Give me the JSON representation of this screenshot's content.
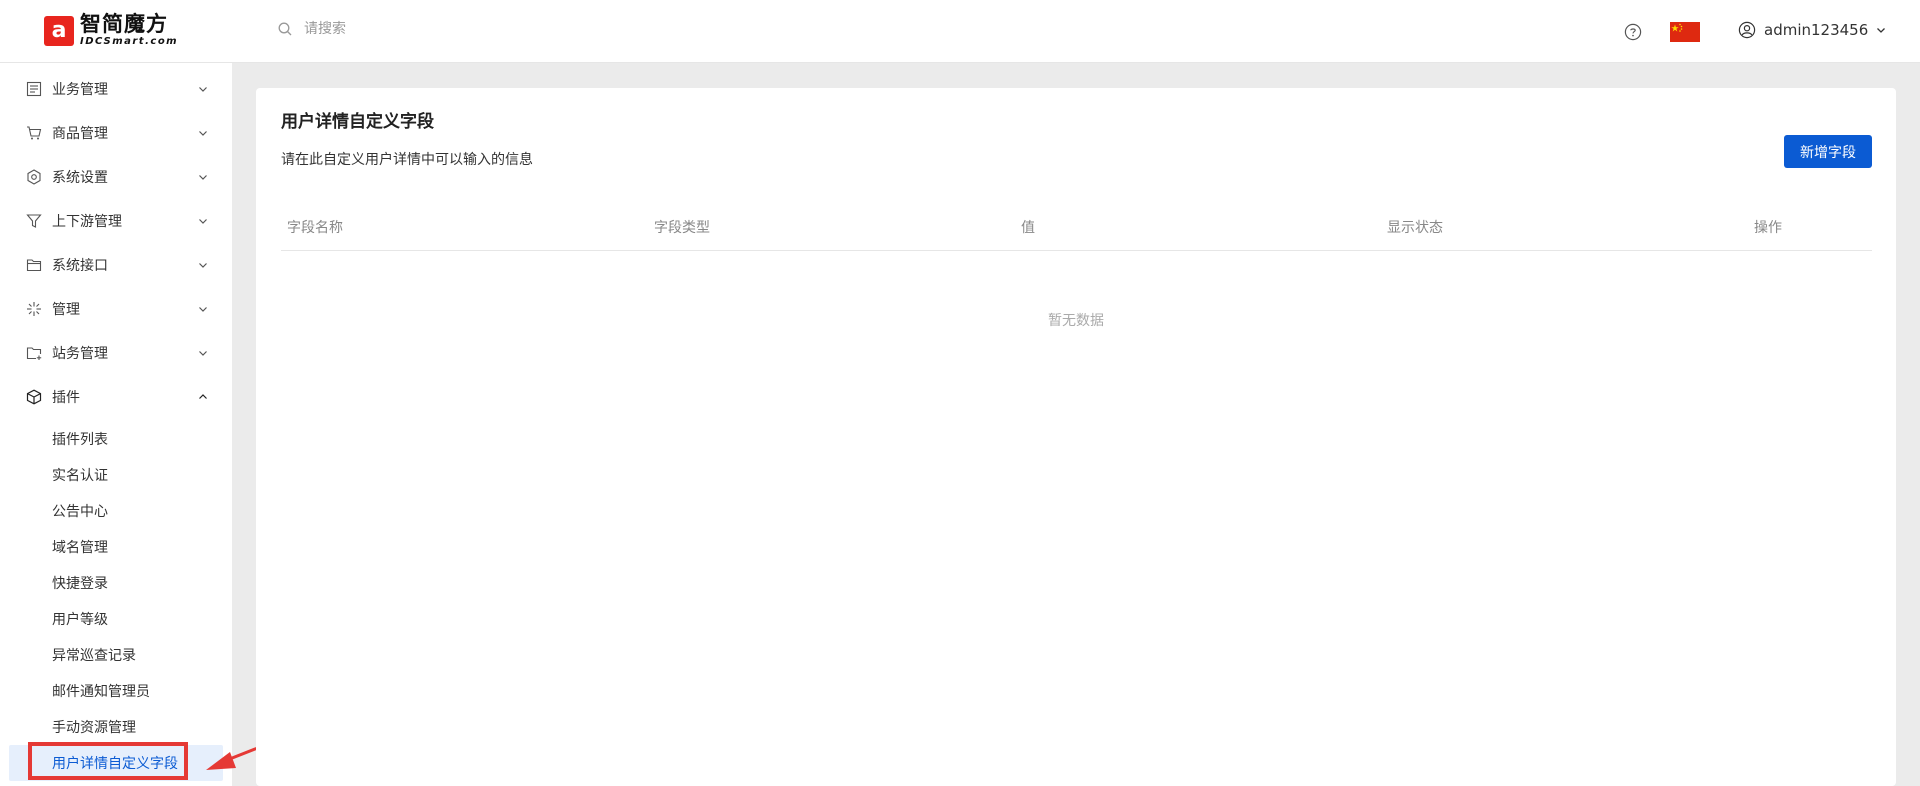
{
  "brand": {
    "logo_mark": "a",
    "name_cn": "智简魔方",
    "name_en": "IDCSmart.com"
  },
  "search": {
    "placeholder": "请搜索",
    "icon": "search-icon"
  },
  "header": {
    "help_icon": "help-icon",
    "flag": "china-flag",
    "flag_color": "#de2910",
    "username": "admin123456"
  },
  "sidebar": {
    "items": [
      {
        "label": "业务管理",
        "icon": "document-list-icon",
        "expanded": false
      },
      {
        "label": "商品管理",
        "icon": "cart-icon",
        "expanded": false
      },
      {
        "label": "系统设置",
        "icon": "settings-icon",
        "expanded": false
      },
      {
        "label": "上下游管理",
        "icon": "filter-icon",
        "expanded": false
      },
      {
        "label": "系统接口",
        "icon": "folder-icon",
        "expanded": false
      },
      {
        "label": "管理",
        "icon": "sparkle-icon",
        "expanded": false
      },
      {
        "label": "站务管理",
        "icon": "folder-add-icon",
        "expanded": false
      },
      {
        "label": "插件",
        "icon": "cube-icon",
        "expanded": true
      }
    ],
    "plugin_children": [
      {
        "label": "插件列表"
      },
      {
        "label": "实名认证"
      },
      {
        "label": "公告中心"
      },
      {
        "label": "域名管理"
      },
      {
        "label": "快捷登录"
      },
      {
        "label": "用户等级"
      },
      {
        "label": "异常巡查记录"
      },
      {
        "label": "邮件通知管理员"
      },
      {
        "label": "手动资源管理"
      },
      {
        "label": "用户详情自定义字段",
        "active": true
      }
    ]
  },
  "main": {
    "title": "用户详情自定义字段",
    "description": "请在此自定义用户详情中可以输入的信息",
    "add_button": "新增字段",
    "columns": [
      "字段名称",
      "字段类型",
      "值",
      "显示状态",
      "操作"
    ],
    "empty_text": "暂无数据"
  },
  "colors": {
    "primary": "#0b5bd3",
    "annotation": "#e53935"
  }
}
